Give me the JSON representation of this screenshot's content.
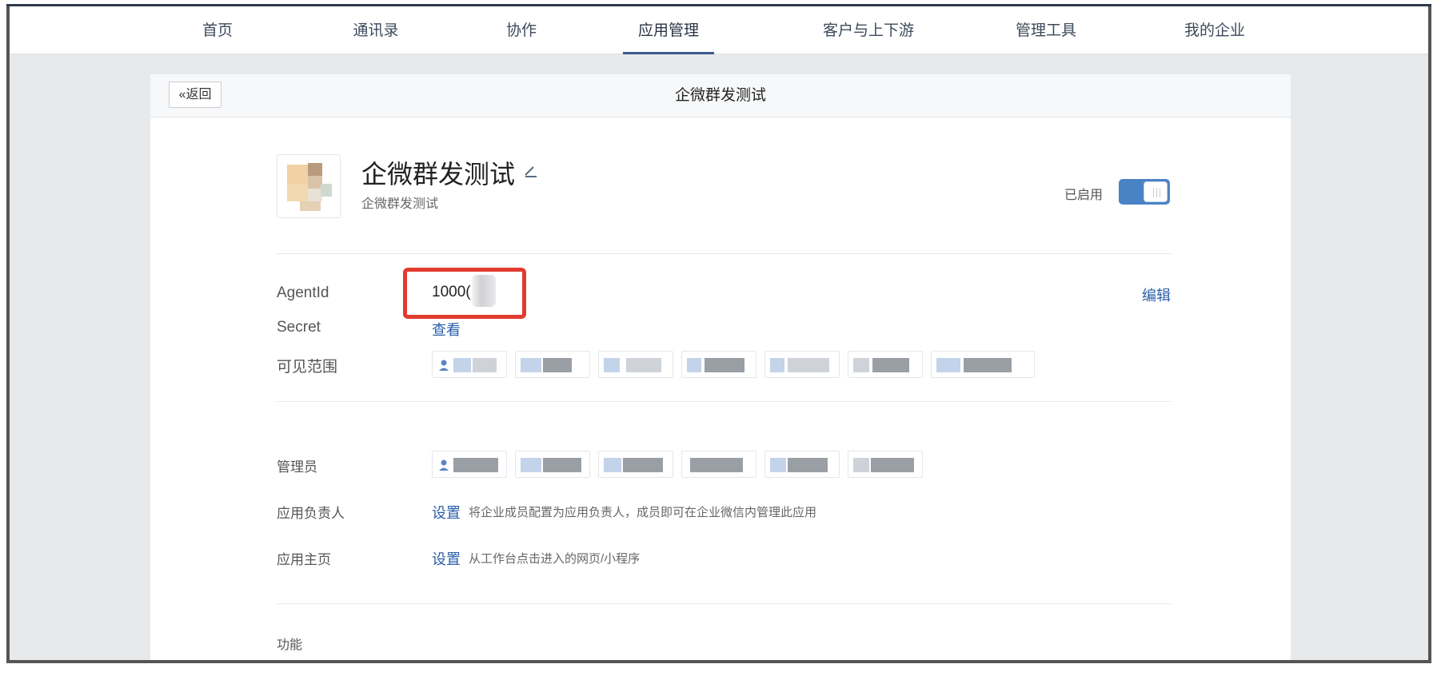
{
  "nav": {
    "items": [
      {
        "label": "首页"
      },
      {
        "label": "通讯录"
      },
      {
        "label": "协作"
      },
      {
        "label": "应用管理",
        "active": true
      },
      {
        "label": "客户与上下游"
      },
      {
        "label": "管理工具"
      },
      {
        "label": "我的企业"
      }
    ]
  },
  "header": {
    "back_label": "«返回",
    "title": "企微群发测试"
  },
  "app": {
    "name": "企微群发测试",
    "description": "企微群发测试",
    "status_label": "已启用",
    "enabled": true,
    "edit_icon": "pencil-icon"
  },
  "details": {
    "agentid_label": "AgentId",
    "agentid_value": "1000(",
    "edit_label": "编辑",
    "secret_label": "Secret",
    "secret_link": "查看",
    "visibility_label": "可见范围"
  },
  "settings": {
    "admin_label": "管理员",
    "owner_label": "应用负责人",
    "owner_link": "设置",
    "owner_hint": "将企业成员配置为应用负责人，成员即可在企业微信内管理此应用",
    "homepage_label": "应用主页",
    "homepage_link": "设置",
    "homepage_hint": "从工作台点击进入的网页/小程序"
  },
  "features": {
    "label": "功能"
  },
  "colors": {
    "accent": "#3a5b8c",
    "link": "#2a5ea8",
    "toggle_on": "#4a82c6",
    "highlight": "#e23b2e"
  }
}
